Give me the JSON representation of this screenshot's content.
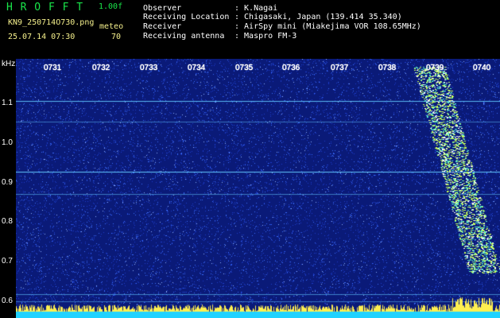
{
  "header": {
    "title": "H R O F F T",
    "version": "1.00f",
    "filename": "KN9_250714O730.png",
    "datetime": "25.07.14 07:30",
    "mode": "meteo",
    "mode_value": "70",
    "observer_label": "Observer",
    "observer_value": ": K.Nagai",
    "location_label": "Receiving Location",
    "location_value": ": Chigasaki, Japan (139.414 35.340)",
    "receiver_label": "Receiver",
    "receiver_value": ": AirSpy mini (Miakejima VOR 108.65MHz)",
    "antenna_label": "Receiving antenna",
    "antenna_value": ": Maspro FM-3"
  },
  "spectrogram": {
    "y_unit": "kHz",
    "y_ticks": [
      "1.1",
      "1.0",
      "0.9",
      "0.8",
      "0.7",
      "0.6"
    ],
    "x_ticks": [
      "0731",
      "0732",
      "0733",
      "0734",
      "0735",
      "0736",
      "0737",
      "0738",
      "0739",
      "0740"
    ],
    "colors": {
      "background": "#0a1a78",
      "noise": "#3a6cff",
      "line": "#62c8ff",
      "echo": "#c8ff5a",
      "baseline": "#20d2ff",
      "peaks": "#ffef50"
    }
  }
}
